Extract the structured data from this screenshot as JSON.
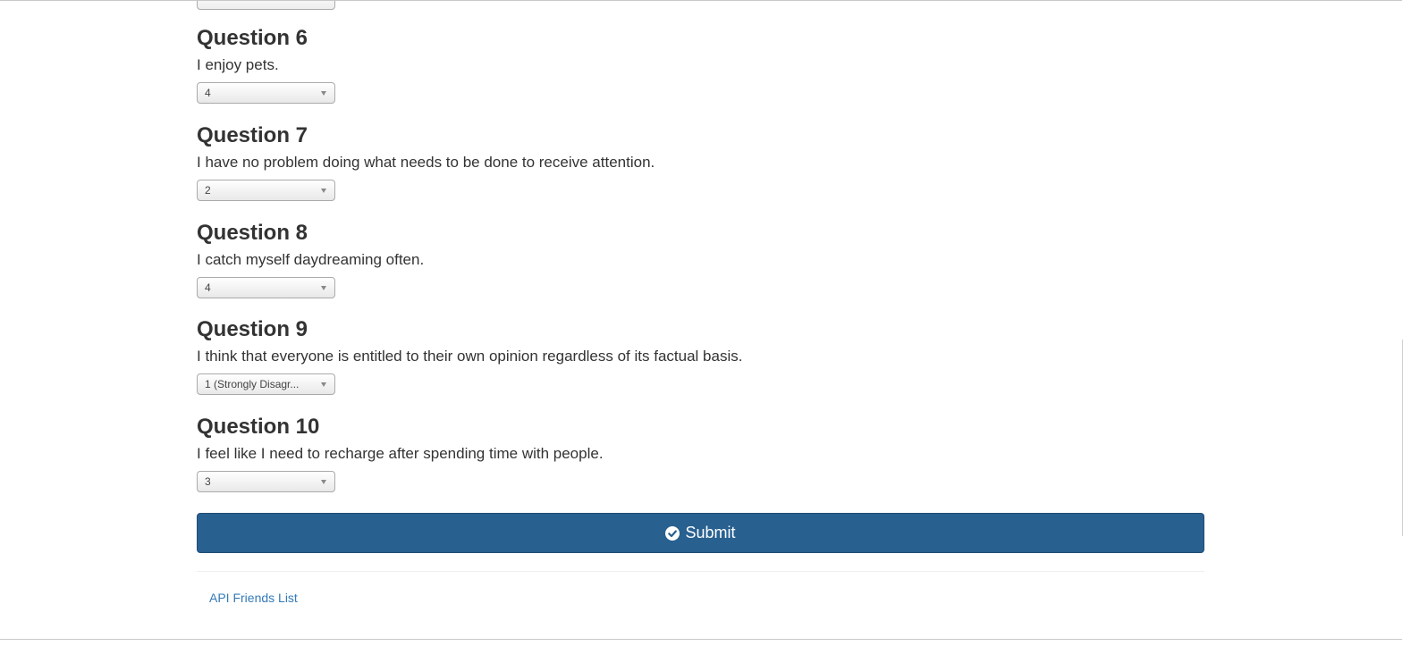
{
  "questions": [
    {
      "title": "Question 6",
      "text": "I enjoy pets.",
      "selected": "4"
    },
    {
      "title": "Question 7",
      "text": "I have no problem doing what needs to be done to receive attention.",
      "selected": "2"
    },
    {
      "title": "Question 8",
      "text": "I catch myself daydreaming often.",
      "selected": "4"
    },
    {
      "title": "Question 9",
      "text": "I think that everyone is entitled to their own opinion regardless of its factual basis.",
      "selected": "1 (Strongly Disagr..."
    },
    {
      "title": "Question 10",
      "text": "I feel like I need to recharge after spending time with people.",
      "selected": "3"
    }
  ],
  "submit": {
    "label": "Submit",
    "icon": "check-circle-icon",
    "color": "#286090"
  },
  "footer": {
    "link_label": "API Friends List",
    "link_color": "#337ab7"
  }
}
